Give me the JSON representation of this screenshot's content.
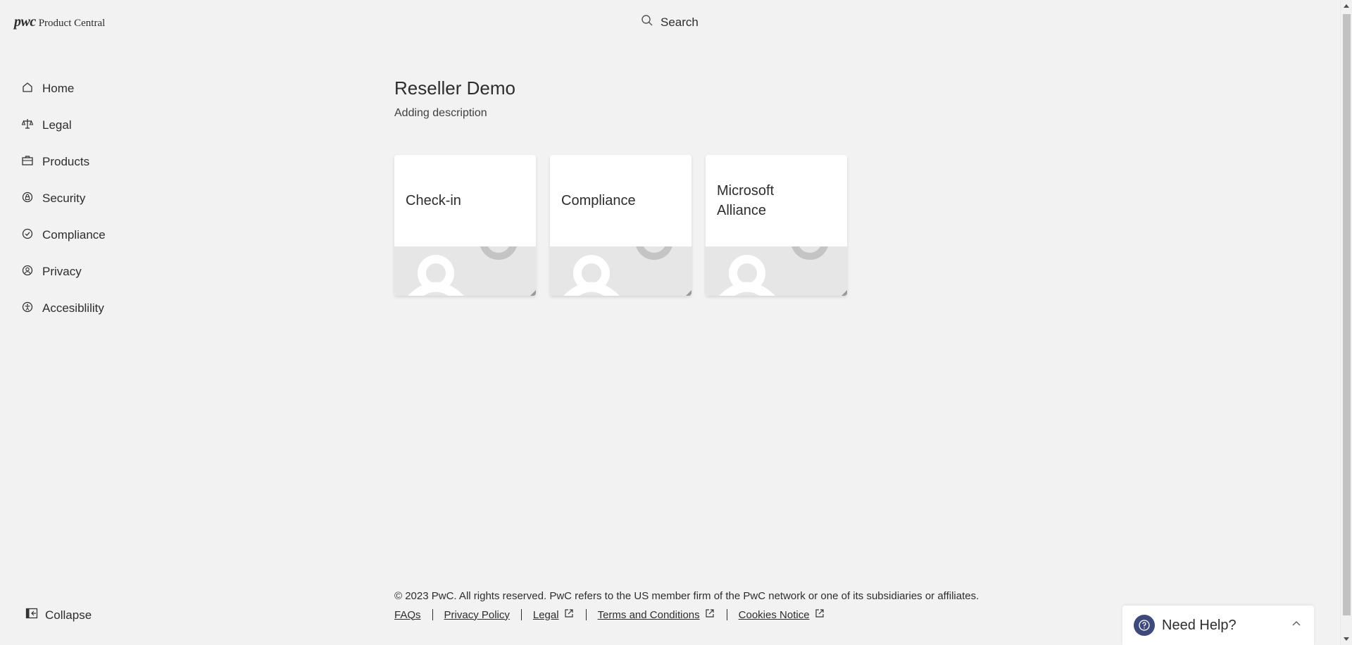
{
  "header": {
    "logo_mark": "pwc",
    "logo_text": "Product Central",
    "search_label": "Search"
  },
  "sidebar": {
    "items": [
      {
        "label": "Home",
        "icon": "home-icon"
      },
      {
        "label": "Legal",
        "icon": "scale-icon"
      },
      {
        "label": "Products",
        "icon": "briefcase-icon"
      },
      {
        "label": "Security",
        "icon": "security-icon"
      },
      {
        "label": "Compliance",
        "icon": "check-circle-icon"
      },
      {
        "label": "Privacy",
        "icon": "privacy-user-icon"
      },
      {
        "label": "Accesiblility",
        "icon": "accessibility-icon"
      }
    ],
    "collapse_label": "Collapse"
  },
  "main": {
    "title": "Reseller Demo",
    "description": "Adding description",
    "cards": [
      {
        "title": "Check-in"
      },
      {
        "title": "Compliance"
      },
      {
        "title": "Microsoft Alliance"
      }
    ]
  },
  "footer": {
    "copyright": "© 2023 PwC. All rights reserved. PwC refers to the US member firm of the PwC network or one of its subsidiaries or affiliates.",
    "links": [
      {
        "label": "FAQs",
        "external": false
      },
      {
        "label": "Privacy Policy",
        "external": false
      },
      {
        "label": "Legal",
        "external": true
      },
      {
        "label": "Terms and Conditions",
        "external": true
      },
      {
        "label": "Cookies Notice",
        "external": true
      }
    ]
  },
  "help_widget": {
    "label": "Need Help?",
    "icon_color": "#3d4a7a"
  }
}
